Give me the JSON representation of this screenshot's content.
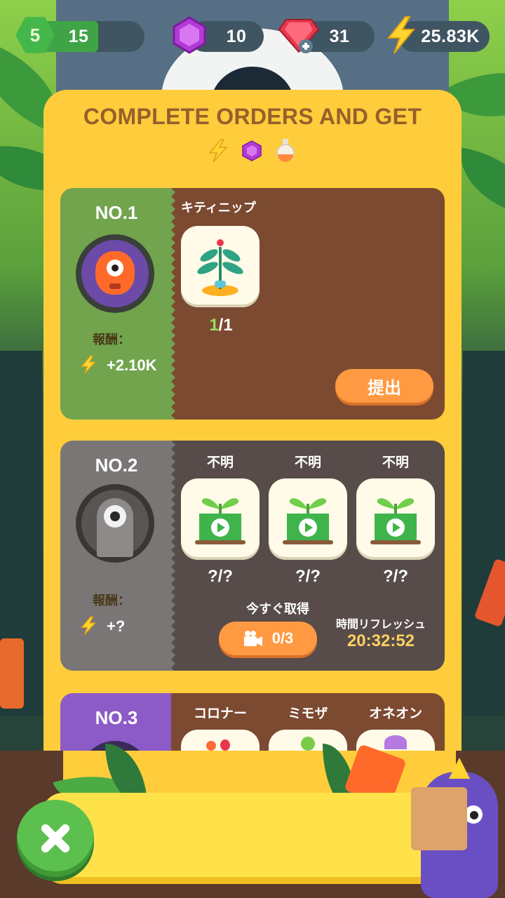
{
  "hud": {
    "level": "5",
    "xp_value": "15",
    "purple_gems": "10",
    "red_gems": "31",
    "energy": "25.83K"
  },
  "panel": {
    "title": "COMPLETE ORDERS AND GET"
  },
  "orders": [
    {
      "number": "NO.1",
      "reward_label": "報酬：",
      "reward_value": "+2.10K",
      "items": [
        {
          "name": "キティニップ",
          "count_have": "1",
          "count_total": "/1"
        }
      ],
      "submit_label": "提出"
    },
    {
      "number": "NO.2",
      "reward_label": "報酬：",
      "reward_value": "+?",
      "items": [
        {
          "name": "不明",
          "count": "?/?"
        },
        {
          "name": "不明",
          "count": "?/?"
        },
        {
          "name": "不明",
          "count": "?/?"
        }
      ],
      "get_now_label": "今すぐ取得",
      "video_count": "0/3",
      "refresh_label": "時間リフレッシュ",
      "refresh_timer": "20:32:52"
    },
    {
      "number": "NO.3",
      "items": [
        {
          "name": "コロナー"
        },
        {
          "name": "ミモザ"
        },
        {
          "name": "オネオン"
        }
      ]
    }
  ],
  "colors": {
    "panel": "#ffcd3c",
    "order1_left": "#71a44d",
    "order1_right": "#7c4a31",
    "order2_left": "#7a7676",
    "order2_right": "#574c4a",
    "order3_left": "#8c5bc7",
    "accent_orange": "#ff9a42",
    "timer": "#ffd060"
  }
}
